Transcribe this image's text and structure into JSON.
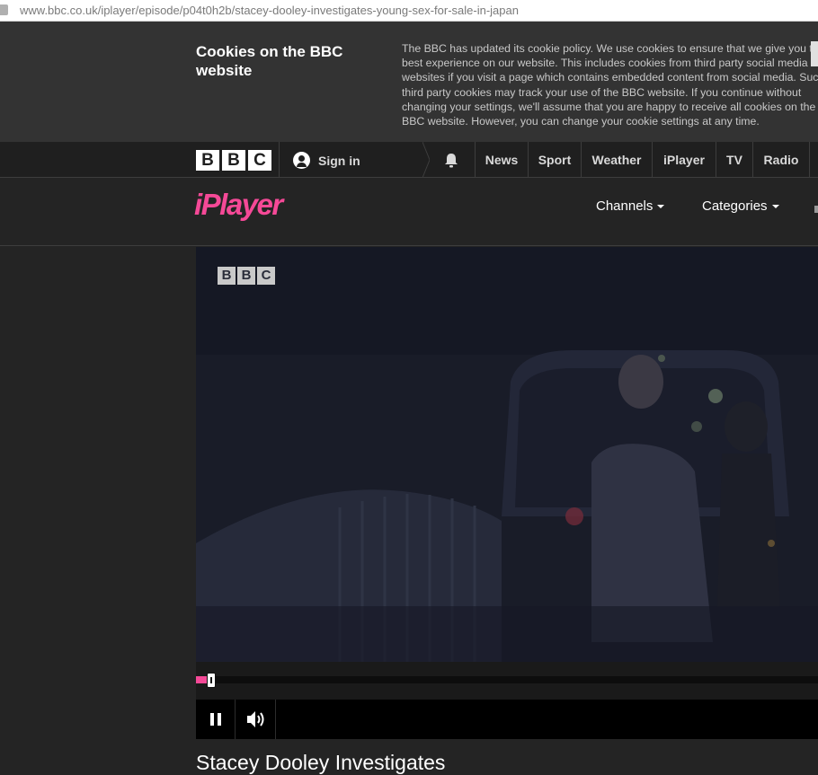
{
  "browser": {
    "url": "www.bbc.co.uk/iplayer/episode/p04t0h2b/stacey-dooley-investigates-young-sex-for-sale-in-japan"
  },
  "cookie_banner": {
    "title": "Cookies on the BBC website",
    "lines": [
      "The BBC has updated its cookie policy. We use cookies to ensure that we give you the",
      "best experience on our website. This includes cookies from third party social media",
      "websites if you visit a page which contains embedded content from social media. Such",
      "third party cookies may track your use of the BBC website. If you continue without",
      "changing your settings, we'll assume that you are happy to receive all cookies on the",
      "BBC website. However, you can change your cookie settings at any time."
    ]
  },
  "bbc_nav": {
    "logo_letters": [
      "B",
      "B",
      "C"
    ],
    "sign_in": "Sign in",
    "links": [
      "News",
      "Sport",
      "Weather",
      "iPlayer",
      "TV",
      "Radio"
    ]
  },
  "iplayer": {
    "logo": "iPlayer",
    "menu": [
      "Channels",
      "Categories"
    ],
    "brand_color": "#f54997"
  },
  "video": {
    "watermark_letters": [
      "B",
      "B",
      "C"
    ],
    "progress_fraction": 0.02
  },
  "episode": {
    "title": "Stacey Dooley Investigates"
  }
}
